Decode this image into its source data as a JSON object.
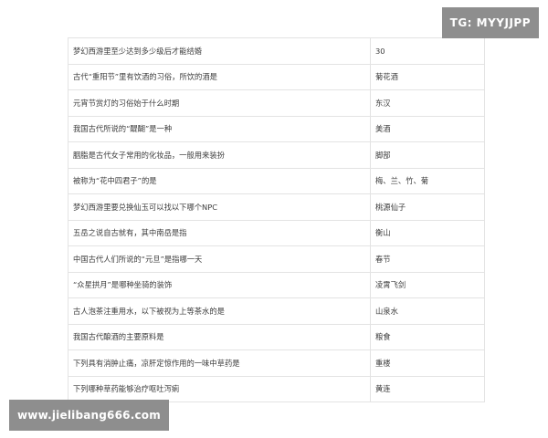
{
  "watermarks": {
    "top_right": "TG: MYYJJPP",
    "bottom_left": "www.jielibang666.com"
  },
  "rows": [
    {
      "question": "梦幻西游里至少达到多少级后才能结婚",
      "answer": "30"
    },
    {
      "question": "古代“重阳节”里有饮酒的习俗，所饮的酒是",
      "answer": "菊花酒"
    },
    {
      "question": "元宵节赏灯的习俗始于什么时期",
      "answer": "东汉"
    },
    {
      "question": "我国古代所说的“醍醐”是一种",
      "answer": "美酒"
    },
    {
      "question": "胭脂是古代女子常用的化妆品，一般用来装扮",
      "answer": "脚部"
    },
    {
      "question": "被称为“花中四君子”的是",
      "answer": "梅、兰、竹、菊"
    },
    {
      "question": "梦幻西游里要兑换仙玉可以找以下哪个NPC",
      "answer": "桃源仙子"
    },
    {
      "question": "五岳之说自古就有，其中南岳是指",
      "answer": "衡山"
    },
    {
      "question": "中国古代人们所说的“元旦”是指哪一天",
      "answer": "春节"
    },
    {
      "question": "“众星拱月”是哪种坐骑的装饰",
      "answer": "凌霄飞剑"
    },
    {
      "question": "古人泡茶注重用水，以下被视为上等茶水的是",
      "answer": "山泉水"
    },
    {
      "question": "我国古代酿酒的主要原料是",
      "answer": "粮食"
    },
    {
      "question": "下列具有消肿止痛，凉肝定惊作用的一味中草药是",
      "answer": "重楼"
    },
    {
      "question": "下列哪种草药能够治疗呕吐泻痢",
      "answer": "黄连"
    }
  ]
}
